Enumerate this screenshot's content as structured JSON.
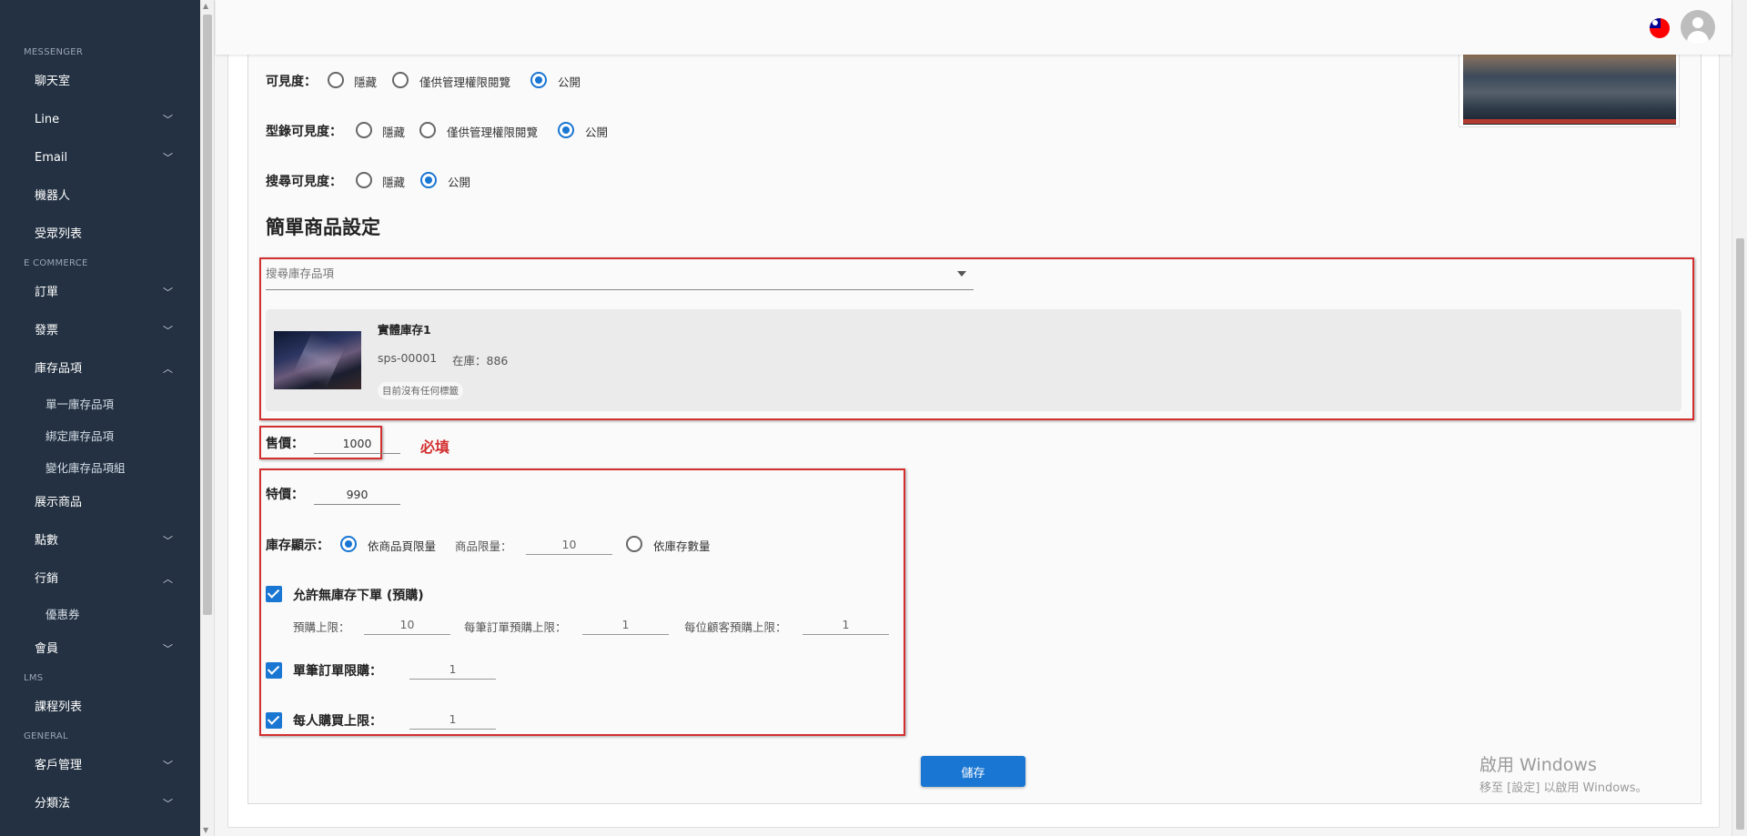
{
  "sidebar": {
    "sections": [
      {
        "title": "MESSENGER",
        "items": [
          {
            "label": "聊天室",
            "chevron": ""
          },
          {
            "label": "Line",
            "chevron": "down"
          },
          {
            "label": "Email",
            "chevron": "down"
          },
          {
            "label": "機器人",
            "chevron": ""
          },
          {
            "label": "受眾列表",
            "chevron": ""
          }
        ]
      },
      {
        "title": "E COMMERCE",
        "items": [
          {
            "label": "訂單",
            "chevron": "down"
          },
          {
            "label": "發票",
            "chevron": "down"
          },
          {
            "label": "庫存品項",
            "chevron": "up",
            "subitems": [
              "單一庫存品項",
              "綁定庫存品項",
              "變化庫存品項組"
            ]
          },
          {
            "label": "展示商品",
            "chevron": ""
          },
          {
            "label": "點數",
            "chevron": "down"
          },
          {
            "label": "行銷",
            "chevron": "up",
            "subitems": [
              "優惠券"
            ]
          },
          {
            "label": "會員",
            "chevron": "down"
          }
        ]
      },
      {
        "title": "LMS",
        "items": [
          {
            "label": "課程列表",
            "chevron": ""
          }
        ]
      },
      {
        "title": "GENERAL",
        "items": [
          {
            "label": "客戶管理",
            "chevron": "down"
          },
          {
            "label": "分類法",
            "chevron": "down"
          }
        ]
      }
    ]
  },
  "visibility": {
    "label": "可見度：",
    "options": [
      "隱藏",
      "僅供管理權限閱覽",
      "公開"
    ],
    "selected": 2
  },
  "catalog_visibility": {
    "label": "型錄可見度：",
    "options": [
      "隱藏",
      "僅供管理權限閱覽",
      "公開"
    ],
    "selected": 2
  },
  "search_visibility": {
    "label": "搜尋可見度：",
    "options": [
      "隱藏",
      "公開"
    ],
    "selected": 1
  },
  "section_title": "簡單商品設定",
  "inventory_search": {
    "placeholder": "搜尋庫存品項"
  },
  "inventory_item": {
    "name": "實體庫存1",
    "sku": "sps-00001",
    "stock": "在庫：886",
    "tag": "目前沒有任何標籤"
  },
  "price": {
    "label": "售價：",
    "value": "1000",
    "required": "必填"
  },
  "special_price": {
    "label": "特價：",
    "value": "990"
  },
  "stock_display": {
    "label": "庫存顯示：",
    "option_by_limit": "依商品頁限量",
    "limit_label": "商品限量：",
    "limit_value": "10",
    "option_by_stock": "依庫存數量",
    "selected": "by_limit"
  },
  "preorder": {
    "label": "允許無庫存下單 (預購)",
    "checked": true,
    "limit_label": "預購上限：",
    "limit_value": "10",
    "per_order_label": "每筆訂單預購上限：",
    "per_order_value": "1",
    "per_customer_label": "每位顧客預購上限：",
    "per_customer_value": "1"
  },
  "order_limit": {
    "label": "單筆訂單限購：",
    "checked": true,
    "value": "1"
  },
  "person_limit": {
    "label": "每人購買上限：",
    "checked": true,
    "value": "1"
  },
  "save_label": "儲存",
  "watermark": {
    "line1": "啟用 Windows",
    "line2": "移至 [設定] 以啟用 Windows。"
  },
  "colors": {
    "sidebar_bg": "#233142",
    "primary": "#1976d2",
    "highlight_red": "#d32f2f"
  }
}
